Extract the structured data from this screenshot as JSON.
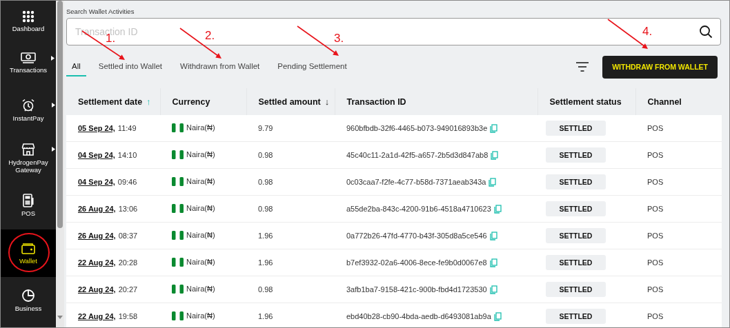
{
  "sidebar": {
    "items": [
      {
        "label": "Dashboard",
        "has_submenu": false,
        "selected": false,
        "circled": false
      },
      {
        "label": "Transactions",
        "has_submenu": true,
        "selected": false,
        "circled": false
      },
      {
        "label": "InstantPay",
        "has_submenu": true,
        "selected": false,
        "circled": false
      },
      {
        "label": "HydrogenPay Gateway",
        "has_submenu": true,
        "selected": false,
        "circled": false
      },
      {
        "label": "POS",
        "has_submenu": false,
        "selected": false,
        "circled": false
      },
      {
        "label": "Wallet",
        "has_submenu": false,
        "selected": true,
        "circled": true
      },
      {
        "label": "Business",
        "has_submenu": false,
        "selected": false,
        "circled": false
      }
    ]
  },
  "search": {
    "label": "Search Wallet Activities",
    "placeholder": "Transaction ID"
  },
  "tabs": [
    {
      "label": "All",
      "selected": true
    },
    {
      "label": "Settled into Wallet",
      "selected": false
    },
    {
      "label": "Withdrawn from Wallet",
      "selected": false
    },
    {
      "label": "Pending Settlement",
      "selected": false
    }
  ],
  "withdraw_button": "WITHDRAW FROM WALLET",
  "table": {
    "columns": [
      {
        "label": "Settlement date",
        "sort_arrow": "↑"
      },
      {
        "label": "Currency"
      },
      {
        "label": "Settled amount",
        "sort_arrow": "↓"
      },
      {
        "label": "Transaction ID"
      },
      {
        "label": "Settlement status"
      },
      {
        "label": "Channel"
      }
    ],
    "rows": [
      {
        "date": "05 Sep 24,",
        "time": "11:49",
        "currency": "Naira(₦)",
        "amount": "9.79",
        "transaction_id": "960bfbdb-32f6-4465-b073-949016893b3e",
        "status": "SETTLED",
        "channel": "POS"
      },
      {
        "date": "04 Sep 24,",
        "time": "14:10",
        "currency": "Naira(₦)",
        "amount": "0.98",
        "transaction_id": "45c40c11-2a1d-42f5-a657-2b5d3d847ab8",
        "status": "SETTLED",
        "channel": "POS"
      },
      {
        "date": "04 Sep 24,",
        "time": "09:46",
        "currency": "Naira(₦)",
        "amount": "0.98",
        "transaction_id": "0c03caa7-f2fe-4c77-b58d-7371aeab343a",
        "status": "SETTLED",
        "channel": "POS"
      },
      {
        "date": "26 Aug 24,",
        "time": "13:06",
        "currency": "Naira(₦)",
        "amount": "0.98",
        "transaction_id": "a55de2ba-843c-4200-91b6-4518a4710623",
        "status": "SETTLED",
        "channel": "POS"
      },
      {
        "date": "26 Aug 24,",
        "time": "08:37",
        "currency": "Naira(₦)",
        "amount": "1.96",
        "transaction_id": "0a772b26-47fd-4770-b43f-305d8a5ce546",
        "status": "SETTLED",
        "channel": "POS"
      },
      {
        "date": "22 Aug 24,",
        "time": "20:28",
        "currency": "Naira(₦)",
        "amount": "1.96",
        "transaction_id": "b7ef3932-02a6-4006-8ece-fe9b0d0067e8",
        "status": "SETTLED",
        "channel": "POS"
      },
      {
        "date": "22 Aug 24,",
        "time": "20:27",
        "currency": "Naira(₦)",
        "amount": "0.98",
        "transaction_id": "3afb1ba7-9158-421c-900b-fbd4d1723530",
        "status": "SETTLED",
        "channel": "POS"
      },
      {
        "date": "22 Aug 24,",
        "time": "19:58",
        "currency": "Naira(₦)",
        "amount": "1.96",
        "transaction_id": "ebd40b28-cb90-4bda-aedb-d6493081ab9a",
        "status": "SETTLED",
        "channel": "POS"
      }
    ]
  },
  "annotations": [
    {
      "label": "1."
    },
    {
      "label": "2."
    },
    {
      "label": "3."
    },
    {
      "label": "4."
    }
  ]
}
